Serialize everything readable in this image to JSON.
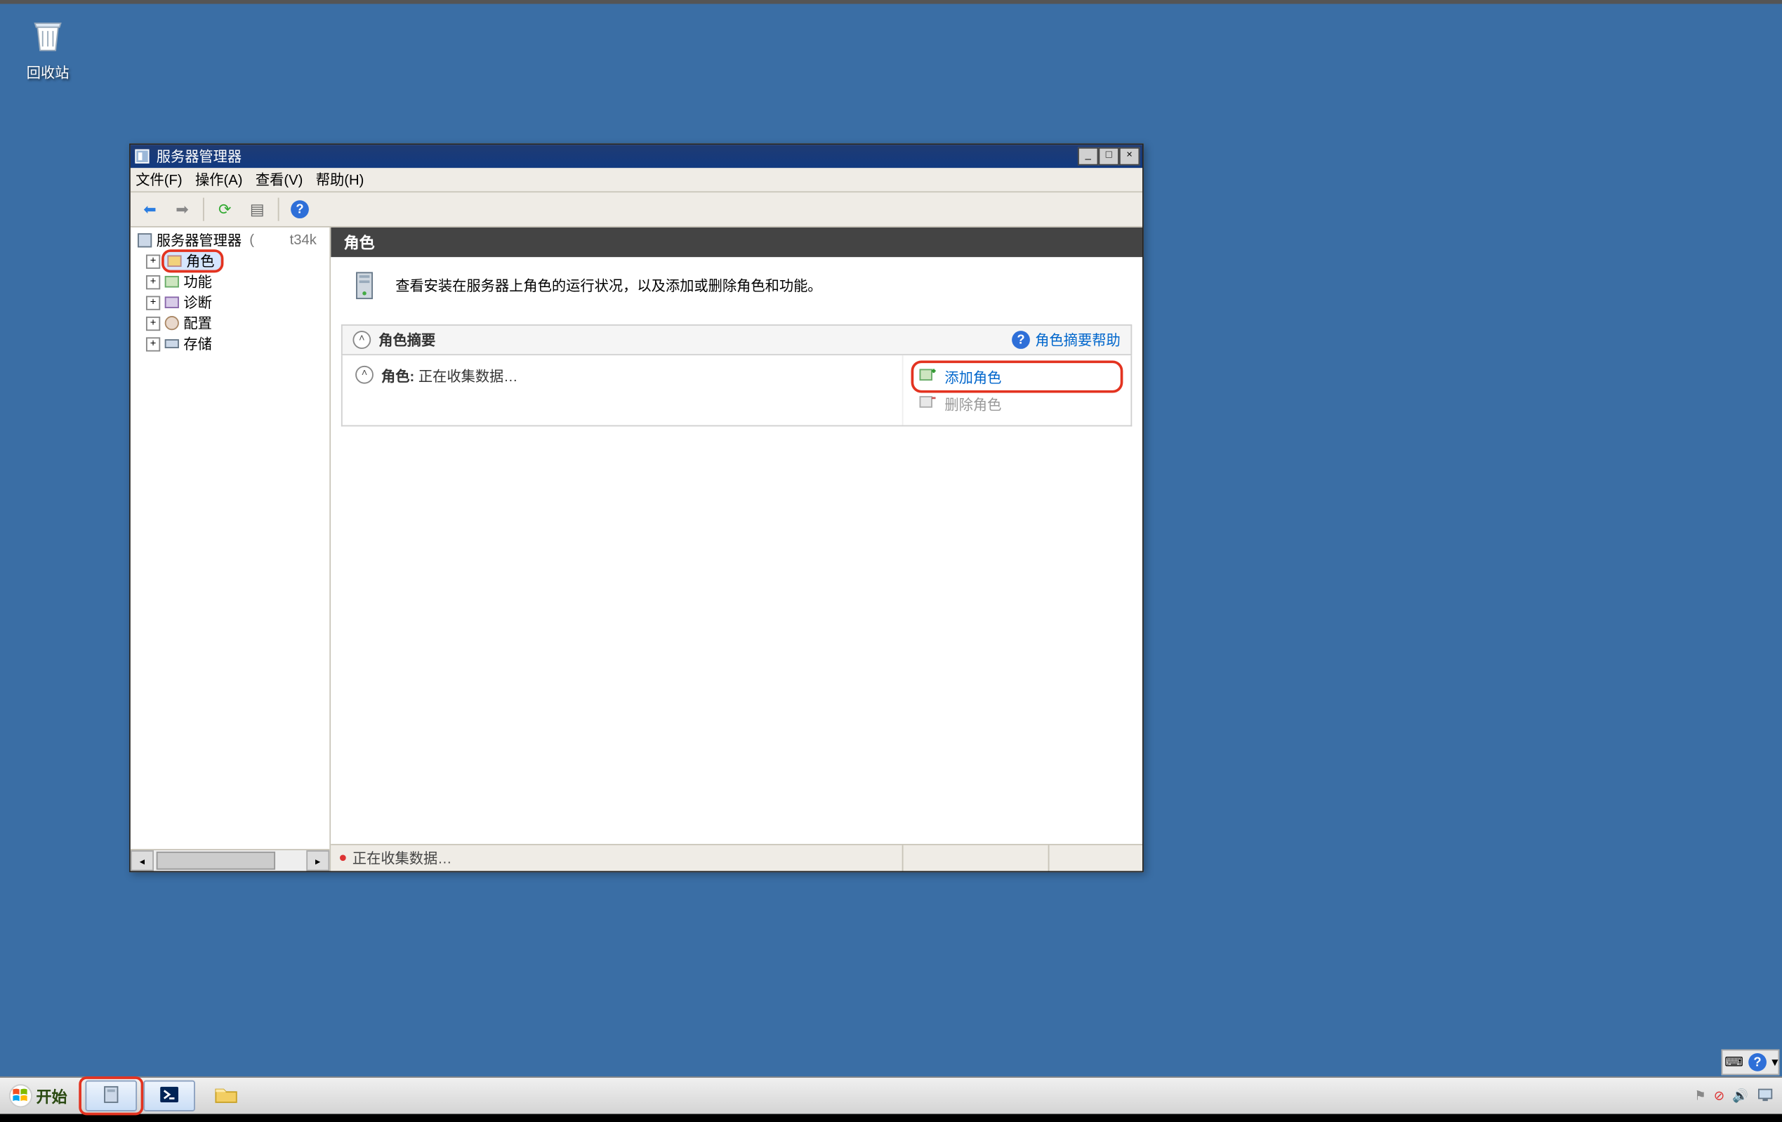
{
  "desktop": {
    "recycle_bin_label": "回收站"
  },
  "window": {
    "title": "服务器管理器",
    "menu": {
      "file": "文件(F)",
      "action": "操作(A)",
      "view": "查看(V)",
      "help": "帮助(H)"
    },
    "tree": {
      "root": "服务器管理器",
      "root_suffix": "t34k",
      "roles": "角色",
      "features": "功能",
      "diagnostics": "诊断",
      "configuration": "配置",
      "storage": "存储"
    },
    "pane": {
      "header": "角色",
      "summary_text": "查看安装在服务器上角色的运行状况，以及添加或删除角色和功能。",
      "section_title": "角色摘要",
      "help_link": "角色摘要帮助",
      "roles_label": "角色:",
      "roles_status": "正在收集数据…",
      "add_roles": "添加角色",
      "remove_roles": "删除角色"
    },
    "status": "正在收集数据…"
  },
  "taskbar": {
    "start": "开始"
  }
}
